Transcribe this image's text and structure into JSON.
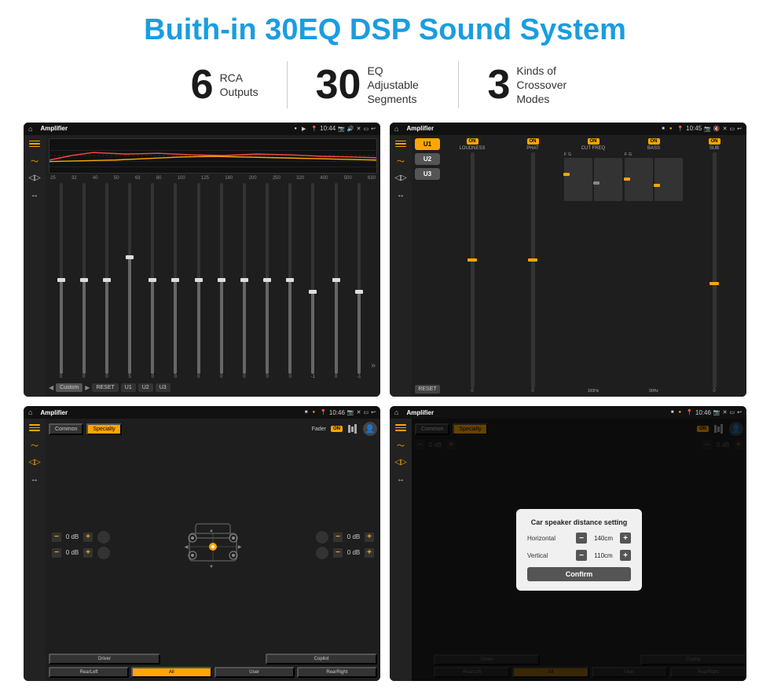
{
  "title": "Buith-in 30EQ DSP Sound System",
  "stats": [
    {
      "number": "6",
      "label": "RCA\nOutputs"
    },
    {
      "number": "30",
      "label": "EQ Adjustable\nSegments"
    },
    {
      "number": "3",
      "label": "Kinds of\nCrossover Modes"
    }
  ],
  "screens": {
    "eq": {
      "app_name": "Amplifier",
      "time": "10:44",
      "freq_labels": [
        "25",
        "32",
        "40",
        "50",
        "63",
        "80",
        "100",
        "125",
        "160",
        "200",
        "250",
        "320",
        "400",
        "500",
        "630"
      ],
      "slider_values": [
        "0",
        "0",
        "0",
        "5",
        "0",
        "0",
        "0",
        "0",
        "0",
        "0",
        "0",
        "-1",
        "0",
        "-1"
      ],
      "buttons": [
        "Custom",
        "RESET",
        "U1",
        "U2",
        "U3"
      ]
    },
    "crossover": {
      "app_name": "Amplifier",
      "time": "10:45",
      "units": [
        "U1",
        "U2",
        "U3"
      ],
      "channels": [
        "LOUDNESS",
        "PHAT",
        "CUT FREQ",
        "BASS",
        "SUB"
      ],
      "on_labels": [
        "ON",
        "ON",
        "ON",
        "ON",
        "ON"
      ]
    },
    "fader": {
      "app_name": "Amplifier",
      "time": "10:46",
      "tabs": [
        "Common",
        "Specialty"
      ],
      "fader_label": "Fader",
      "on_label": "ON",
      "db_values": [
        "0 dB",
        "0 dB",
        "0 dB",
        "0 dB"
      ],
      "zone_buttons": [
        "Driver",
        "",
        "",
        "Copilot",
        "RearLeft",
        "All",
        "User",
        "RearRight"
      ]
    },
    "distance": {
      "app_name": "Amplifier",
      "time": "10:46",
      "tabs": [
        "Common",
        "Specialty"
      ],
      "on_label": "ON",
      "modal": {
        "title": "Car speaker distance setting",
        "horizontal_label": "Horizontal",
        "horizontal_value": "140cm",
        "vertical_label": "Vertical",
        "vertical_value": "110cm",
        "confirm_label": "Confirm"
      },
      "db_values": [
        "0 dB",
        "0 dB"
      ],
      "zone_buttons": [
        "Driver",
        "Copilot",
        "RearLeft",
        "User",
        "RearRight"
      ]
    }
  }
}
